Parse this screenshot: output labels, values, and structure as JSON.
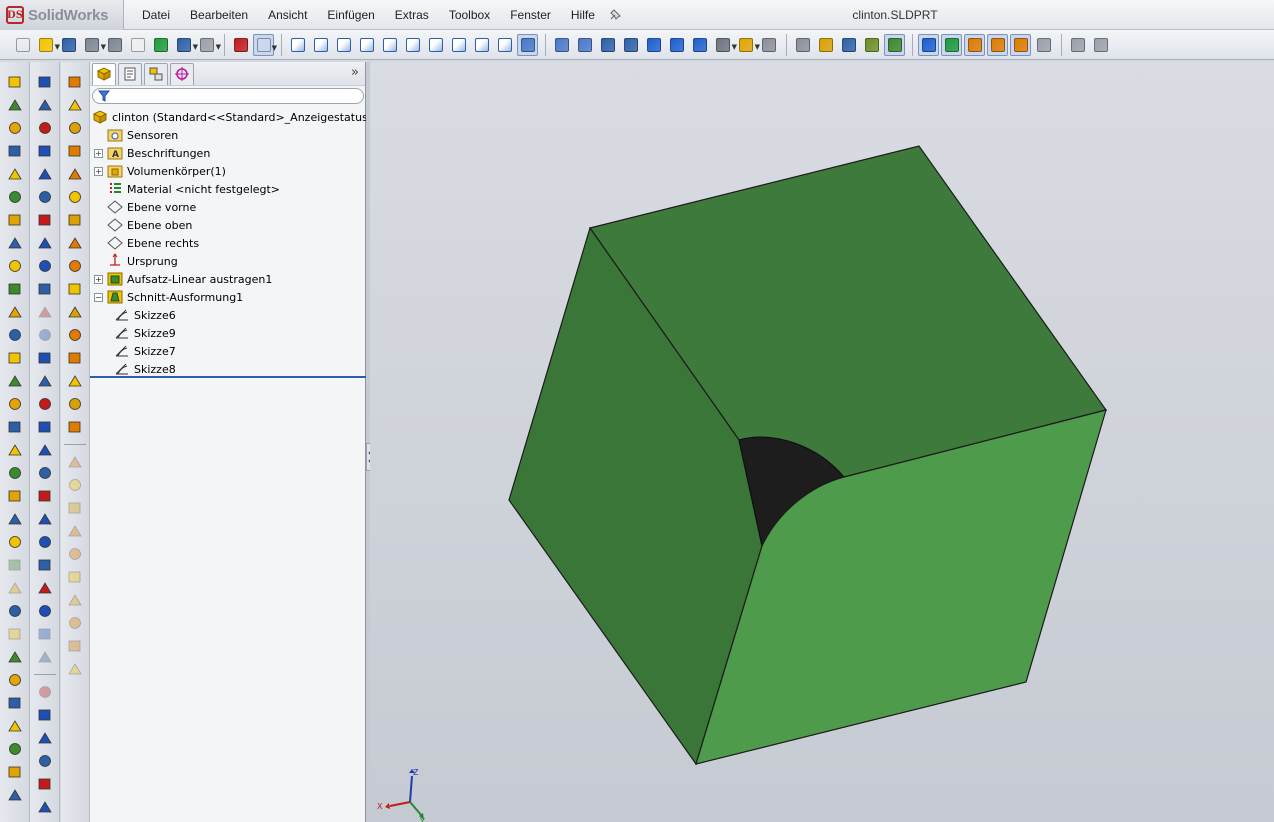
{
  "app": {
    "brand": "SolidWorks",
    "logo_mark": "DS",
    "document_title": "clinton.SLDPRT"
  },
  "menu": [
    "Datei",
    "Bearbeiten",
    "Ansicht",
    "Einfügen",
    "Extras",
    "Toolbox",
    "Fenster",
    "Hilfe"
  ],
  "toolbar_icons": [
    "new-icon",
    "open-icon",
    "save-icon",
    "print-icon",
    "print-preview-icon",
    "options-icon",
    "rebuild-icon",
    "undo-icon",
    "redo-icon",
    "traffic-light-icon",
    "select-icon",
    "view-front-icon",
    "view-back-icon",
    "view-left-icon",
    "view-right-icon",
    "view-top-icon",
    "view-bottom-icon",
    "view-iso-icon",
    "view-trimetric-icon",
    "view-dimetric-icon",
    "normal-to-icon",
    "zoom-fit-icon",
    "zoom-area-icon",
    "rotate-icon",
    "wireframe-icon",
    "hidden-lines-icon",
    "shaded-edges-icon",
    "shaded-icon",
    "section-view-icon",
    "display-style-icon",
    "appearance-icon",
    "scene-icon",
    "sketch-icon",
    "smart-dimension-icon",
    "relations-icon",
    "sensor-icon",
    "filter-faces-icon",
    "filter-edges-icon",
    "filter-vertices-icon",
    "mold-icon",
    "draft-icon",
    "parting-line-icon",
    "weldment-icon",
    "sheet-metal-icon",
    "routing-icon"
  ],
  "feature_manager": {
    "tabs": [
      "feature-manager-tab",
      "property-manager-tab",
      "configuration-manager-tab",
      "dimxpert-tab"
    ],
    "expand_glyph": "»",
    "tree": [
      {
        "label": "clinton  (Standard<<Standard>_Anzeigestatus 1>)",
        "icon": "part-icon",
        "expander": "",
        "level": 0
      },
      {
        "label": "Sensoren",
        "icon": "sensor-folder-icon",
        "expander": "",
        "level": 1
      },
      {
        "label": "Beschriftungen",
        "icon": "annotations-icon",
        "expander": "+",
        "level": 1
      },
      {
        "label": "Volumenkörper(1)",
        "icon": "solid-bodies-icon",
        "expander": "+",
        "level": 1
      },
      {
        "label": "Material <nicht festgelegt>",
        "icon": "material-icon",
        "expander": "",
        "level": 1
      },
      {
        "label": "Ebene vorne",
        "icon": "plane-icon",
        "expander": "",
        "level": 1
      },
      {
        "label": "Ebene oben",
        "icon": "plane-icon",
        "expander": "",
        "level": 1
      },
      {
        "label": "Ebene rechts",
        "icon": "plane-icon",
        "expander": "",
        "level": 1
      },
      {
        "label": "Ursprung",
        "icon": "origin-icon",
        "expander": "",
        "level": 1
      },
      {
        "label": "Aufsatz-Linear austragen1",
        "icon": "extrude-icon",
        "expander": "+",
        "level": 1
      },
      {
        "label": "Schnitt-Ausformung1",
        "icon": "cut-loft-icon",
        "expander": "−",
        "level": 1
      },
      {
        "label": "Skizze6",
        "icon": "sketch-icon",
        "expander": "",
        "level": 2
      },
      {
        "label": "Skizze9",
        "icon": "sketch-icon",
        "expander": "",
        "level": 2
      },
      {
        "label": "Skizze7",
        "icon": "sketch-icon",
        "expander": "",
        "level": 2
      },
      {
        "label": "Skizze8",
        "icon": "sketch-icon",
        "expander": "",
        "level": 2
      }
    ]
  },
  "model": {
    "body_color_dark": "#3a7339",
    "body_color_light": "#4f9b4c",
    "cut_color": "#1a1a1a",
    "edge_color": "#1b1b1b"
  },
  "triad": {
    "x_label": "X",
    "y_label": "Y",
    "z_label": "Z"
  },
  "colors": {
    "accent": "#2d5fa8",
    "viewport_bg": "#cdd1d8"
  }
}
